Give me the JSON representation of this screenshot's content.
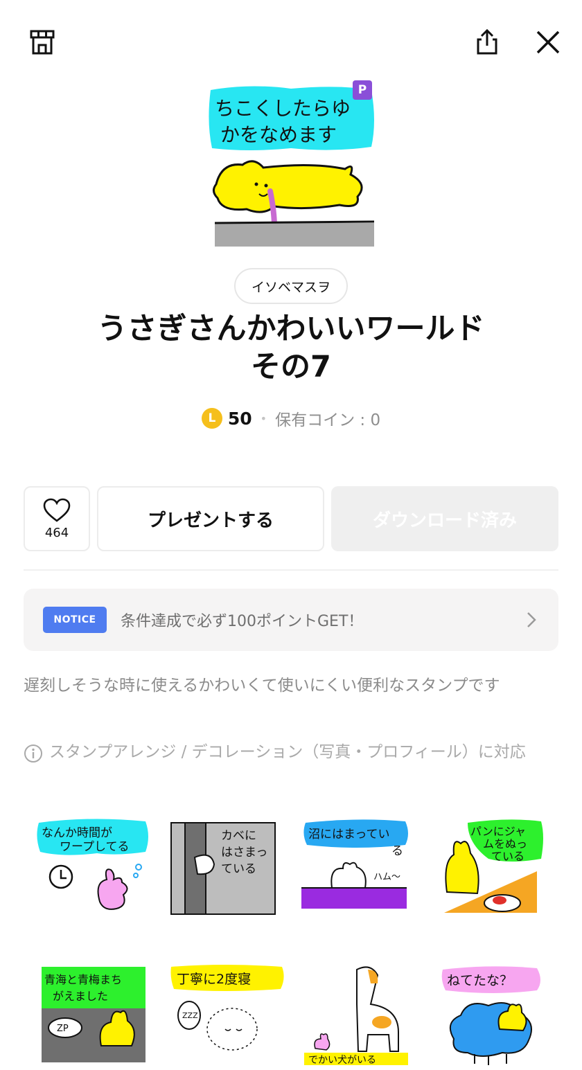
{
  "header": {
    "shop_icon": "shop-icon",
    "share_icon": "share-icon",
    "close_icon": "close-icon"
  },
  "hero": {
    "badge": "P",
    "text_lines": [
      "ちこくしたらゆ",
      "かをなめます"
    ],
    "colors": {
      "bubble": "#28e6f2",
      "rabbit": "#fff200",
      "floor": "#a9a9a9",
      "badge": "#8a4fd8"
    }
  },
  "author": "イソベマスヲ",
  "title_lines": [
    "うさぎさんかわいいワールド",
    "その7"
  ],
  "price": {
    "coin_letter": "L",
    "amount": "50",
    "owned": "保有コイン : 0"
  },
  "actions": {
    "like_count": "464",
    "present_label": "プレゼントする",
    "download_label": "ダウンロード済み"
  },
  "notice": {
    "tag": "NOTICE",
    "text": "条件達成で必ず100ポイントGET！"
  },
  "description": "遅刻しそうな時に使えるかわいくて使いにくい便利なスタンプです",
  "feature_note": "スタンプアレンジ / デコレーション（写真・プロフィール）に対応",
  "stickers": [
    {
      "lines": [
        "なんか時間が",
        "ワープしてる"
      ],
      "bubble": "#28e6f2",
      "char": "#f7a6f0"
    },
    {
      "lines": [
        "カベに",
        "はさまっ",
        "ている"
      ],
      "bubble": "#bdbdbd",
      "char": "#ffffff"
    },
    {
      "lines": [
        "沼にはまってい",
        "る"
      ],
      "bubble": "#28a8f2",
      "char": "#ffffff",
      "extra": "ハム〜"
    },
    {
      "lines": [
        "パンにジャ",
        "ムをぬっ",
        "ている"
      ],
      "bubble": "#2df02d",
      "char": "#fff200"
    },
    {
      "lines": [
        "青海と青梅まち",
        "がえました"
      ],
      "bubble": "#2df02d",
      "char": "#fff200",
      "extra": "ZP"
    },
    {
      "lines": [
        "丁寧に2度寝"
      ],
      "bubble": "#fff200",
      "char": "#ffffff",
      "extra": "ZZZ"
    },
    {
      "lines": [
        "でかい犬がいる"
      ],
      "bubble": "#fff200",
      "char": "#ffffff"
    },
    {
      "lines": [
        "ねてたな？"
      ],
      "bubble": "#f7a6f0",
      "char": "#2f9bf0"
    }
  ]
}
